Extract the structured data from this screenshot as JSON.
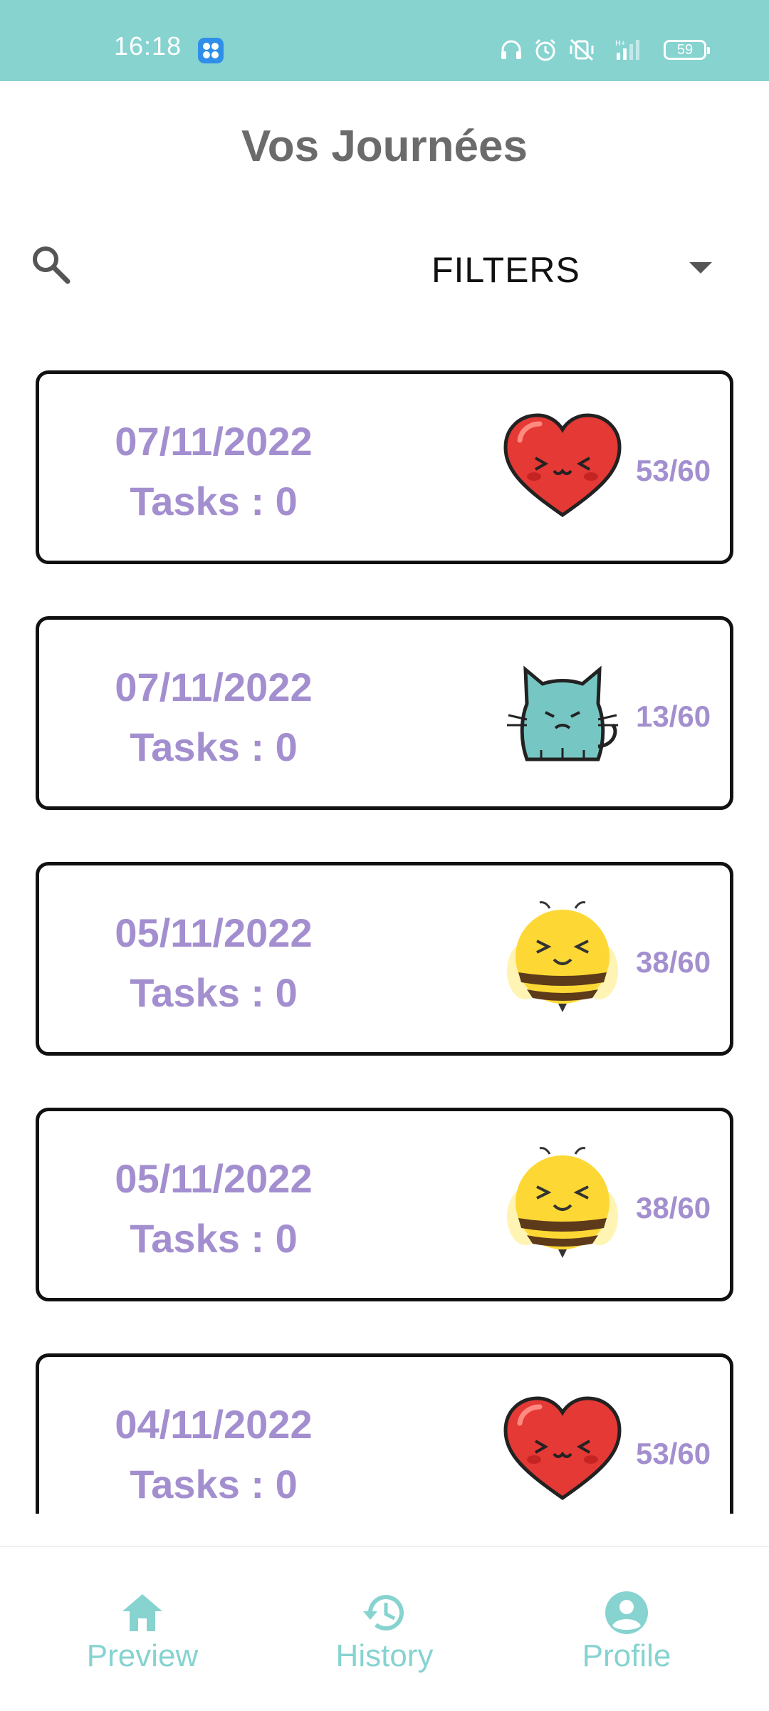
{
  "status_bar": {
    "time": "16:18",
    "battery": "59"
  },
  "header": {
    "title": "Vos Journées"
  },
  "filter": {
    "label": "FILTERS"
  },
  "days": [
    {
      "date": "07/11/2022",
      "tasks_label": "Tasks : 0",
      "score": "53/60",
      "mood_icon": "heart-mood-icon"
    },
    {
      "date": "07/11/2022",
      "tasks_label": "Tasks : 0",
      "score": "13/60",
      "mood_icon": "cat-mood-icon"
    },
    {
      "date": "05/11/2022",
      "tasks_label": "Tasks : 0",
      "score": "38/60",
      "mood_icon": "bee-mood-icon"
    },
    {
      "date": "05/11/2022",
      "tasks_label": "Tasks : 0",
      "score": "38/60",
      "mood_icon": "bee-mood-icon"
    },
    {
      "date": "04/11/2022",
      "tasks_label": "Tasks : 0",
      "score": "53/60",
      "mood_icon": "heart-mood-icon"
    }
  ],
  "bottom_nav": [
    {
      "label": "Preview",
      "icon": "home-icon"
    },
    {
      "label": "History",
      "icon": "history-icon"
    },
    {
      "label": "Profile",
      "icon": "profile-icon"
    }
  ],
  "colors": {
    "accent": "#86d3d0",
    "card_text": "#a38fcf",
    "title": "#6b6b6b"
  }
}
